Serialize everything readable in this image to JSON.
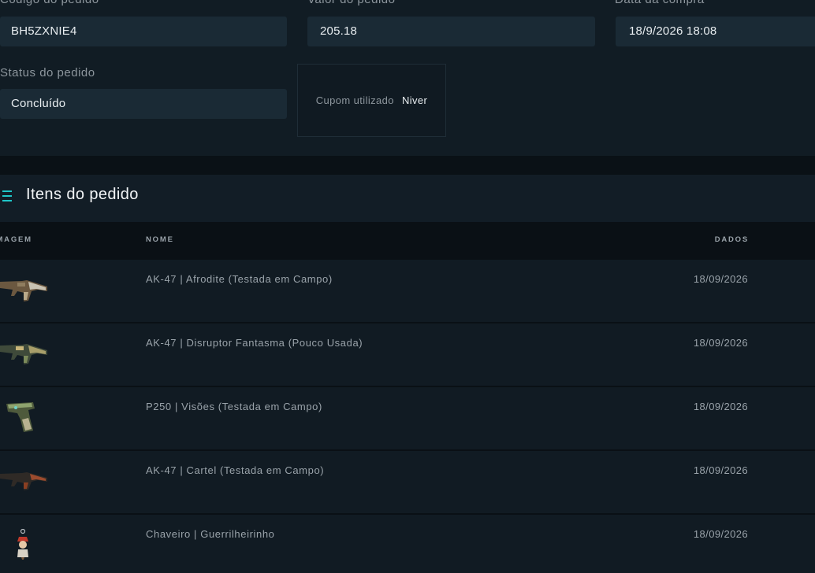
{
  "order": {
    "code_label": "Código do pedido",
    "code_value": "BH5ZXNIE4",
    "value_label": "Valor do pedido",
    "value_value": "205.18",
    "date_label": "Data da compra",
    "date_value": "18/9/2026 18:08",
    "status_label": "Status do pedido",
    "status_value": "Concluído",
    "coupon_label": "Cupom utilizado",
    "coupon_value": "Niver"
  },
  "items": {
    "title": "Itens do pedido",
    "icon": "menu-list-icon",
    "accent_color": "#1fc6c8",
    "columns": {
      "image": "IMAGEM",
      "name": "NOME",
      "date": "DADOS"
    },
    "rows": [
      {
        "name": "AK-47 | Afrodite (Testada em Campo)",
        "date": "18/09/2026",
        "icon": "rifle-icon"
      },
      {
        "name": "AK-47 | Disruptor Fantasma (Pouco Usada)",
        "date": "18/09/2026",
        "icon": "rifle-icon"
      },
      {
        "name": "P250 | Visões (Testada em Campo)",
        "date": "18/09/2026",
        "icon": "pistol-icon"
      },
      {
        "name": "AK-47 | Cartel (Testada em Campo)",
        "date": "18/09/2026",
        "icon": "rifle-icon"
      },
      {
        "name": "Chaveiro | Guerrilheirinho",
        "date": "18/09/2026",
        "icon": "keychain-icon"
      }
    ]
  }
}
